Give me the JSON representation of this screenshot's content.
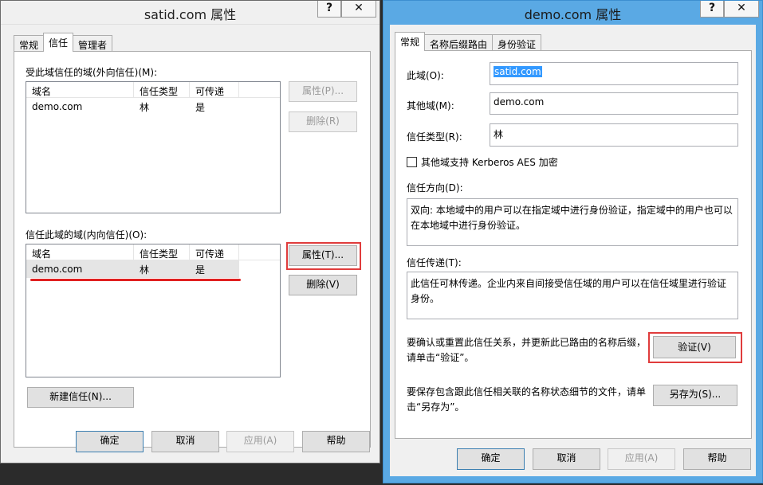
{
  "left_window": {
    "title": "satid.com 属性",
    "help_btn": "?",
    "close_btn": "✕",
    "tabs": [
      "常规",
      "信任",
      "管理者"
    ],
    "outgoing_label": "受此域信任的域(外向信任)(M):",
    "incoming_label": "信任此域的域(内向信任)(O):",
    "columns": [
      "域名",
      "信任类型",
      "可传递"
    ],
    "outgoing_rows": [
      [
        "demo.com",
        "林",
        "是"
      ]
    ],
    "incoming_rows": [
      [
        "demo.com",
        "林",
        "是"
      ]
    ],
    "btn_props_out": "属性(P)...",
    "btn_remove_out": "删除(R)",
    "btn_props_in": "属性(T)...",
    "btn_remove_in": "删除(V)",
    "btn_new_trust": "新建信任(N)...",
    "btn_ok": "确定",
    "btn_cancel": "取消",
    "btn_apply": "应用(A)",
    "btn_help": "帮助"
  },
  "right_window": {
    "title": "demo.com 属性",
    "help_btn": "?",
    "close_btn": "✕",
    "tabs": [
      "常规",
      "名称后缀路由",
      "身份验证"
    ],
    "this_domain_label": "此域(O):",
    "this_domain_value": "satid.com",
    "other_domain_label": "其他域(M):",
    "other_domain_value": "demo.com",
    "trust_type_label": "信任类型(R):",
    "trust_type_value": "林",
    "aes_checkbox": "其他域支持 Kerberos AES 加密",
    "direction_label": "信任方向(D):",
    "direction_text": "双向: 本地域中的用户可以在指定域中进行身份验证，指定域中的用户也可以在本地域中进行身份验证。",
    "transitivity_label": "信任传递(T):",
    "transitivity_text": "此信任可林传递。企业内来自间接受信任域的用户可以在信任域里进行验证身份。",
    "validate_text": "要确认或重置此信任关系，并更新此已路由的名称后缀，请单击“验证”。",
    "btn_validate": "验证(V)",
    "saveas_text": "要保存包含跟此信任相关联的名称状态细节的文件，请单击“另存为”。",
    "btn_saveas": "另存为(S)...",
    "btn_ok": "确定",
    "btn_cancel": "取消",
    "btn_apply": "应用(A)",
    "btn_help": "帮助"
  }
}
